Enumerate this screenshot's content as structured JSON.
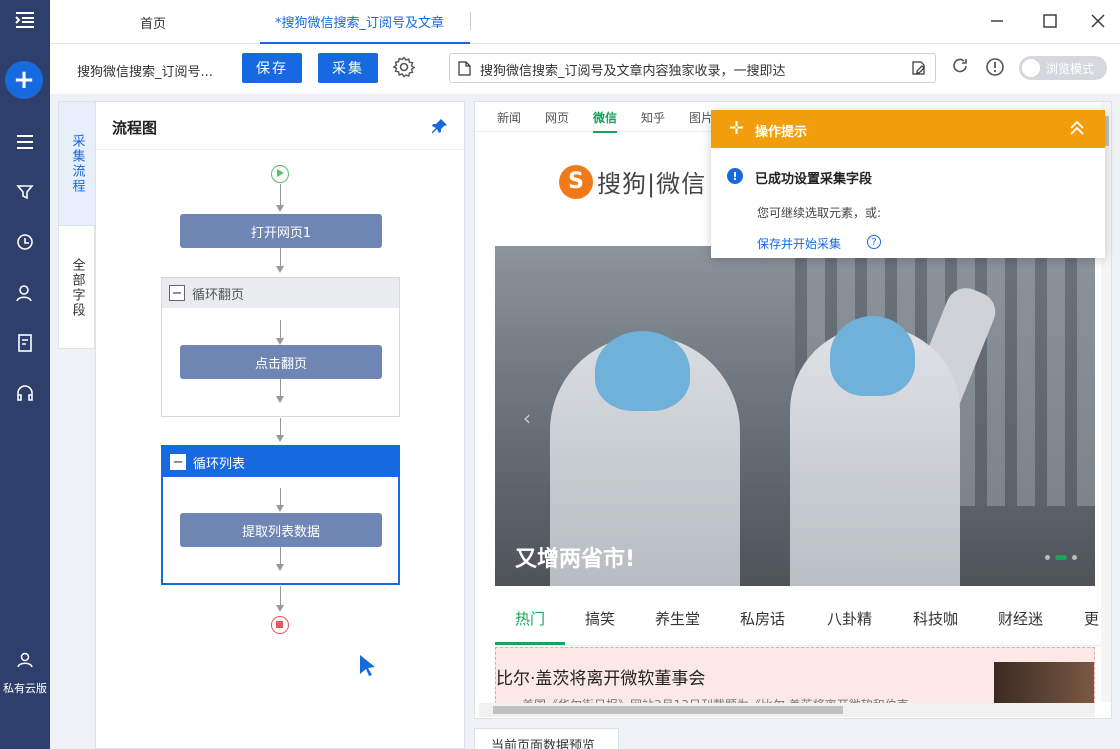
{
  "rail": {
    "user_label": "私有云版"
  },
  "tabs": {
    "home": "首页",
    "active": "*搜狗微信搜索_订阅号及文章"
  },
  "toolbar": {
    "task_title": "搜狗微信搜索_订阅号...",
    "save": "保存",
    "collect": "采集",
    "url": "搜狗微信搜索_订阅号及文章内容独家收录，一搜即达",
    "browse_mode": "浏览模式"
  },
  "side_tabs": {
    "flow": "采集流程",
    "fields": "全部字段"
  },
  "flow": {
    "title": "流程图",
    "open_page": "打开网页1",
    "loop_page": "循环翻页",
    "click_page": "点击翻页",
    "loop_list": "循环列表",
    "extract": "提取列表数据"
  },
  "browser": {
    "nav": [
      "新闻",
      "网页",
      "微信",
      "知乎",
      "图片"
    ],
    "nav_current": "微信",
    "logo_text": "搜狗|微信",
    "logo_mark": "S",
    "banner_caption": "又增两省市!",
    "categories": [
      "热门",
      "搞笑",
      "养生堂",
      "私房话",
      "八卦精",
      "科技咖",
      "财经迷",
      "更"
    ],
    "news_title": "比尔·盖茨将离开微软董事会",
    "news_sub": "美国《华尔街日报》网站3月13日刊载题为《比尔·盖茨将离开微软和伯克"
  },
  "tip": {
    "header": "操作提示",
    "message": "已成功设置采集字段",
    "sub": "您可继续选取元素，或:",
    "link": "保存并开始采集"
  },
  "preview_tab": "当前页面数据预览",
  "colors": {
    "rail": "#2f3f6b",
    "primary": "#1769e0",
    "tip": "#f29e0c",
    "sogou_green": "#1aa35a"
  }
}
